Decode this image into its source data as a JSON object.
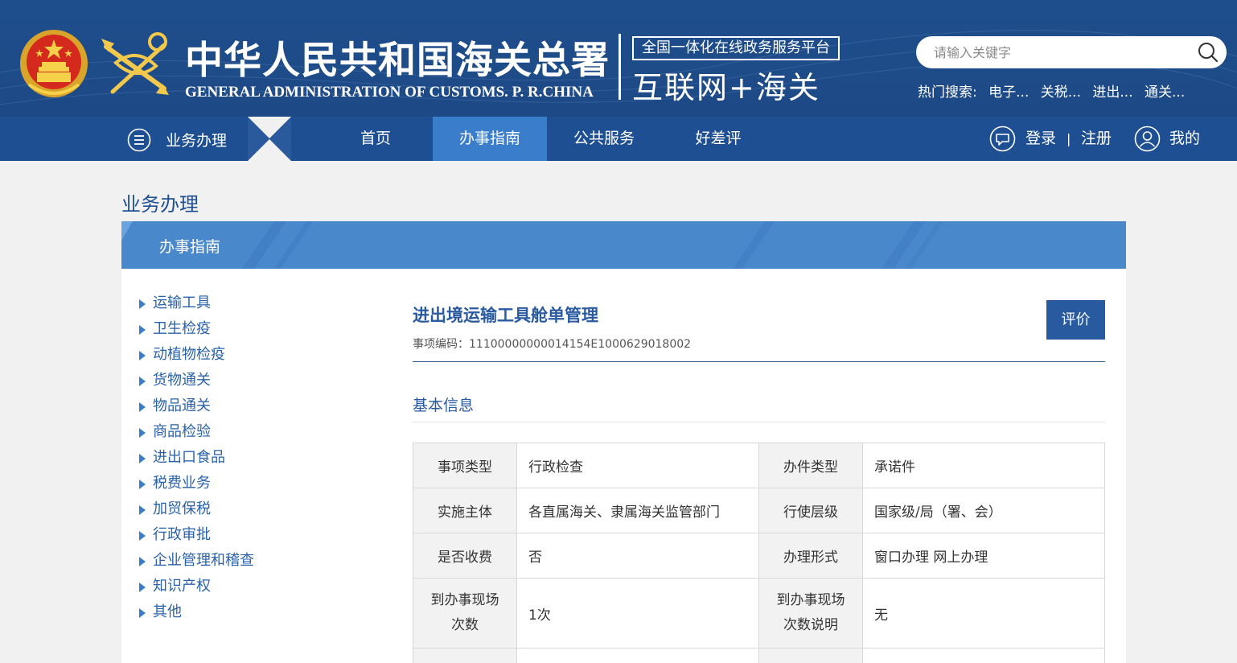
{
  "header": {
    "title_cn": "中华人民共和国海关总署",
    "title_en": "GENERAL ADMINISTRATION OF CUSTOMS. P. R.CHINA",
    "platform_box": "全国一体化在线政务服务平台",
    "platform_big": "互联网+海关",
    "search": {
      "placeholder": "请输入关键字"
    },
    "hot_label": "热门搜索:",
    "hot_items": [
      "电子...",
      "关税...",
      "进出...",
      "通关..."
    ]
  },
  "nav": {
    "biz_label": "业务办理",
    "items": [
      "首页",
      "办事指南",
      "公共服务",
      "好差评"
    ],
    "active_index": 1,
    "login": "登录",
    "separator": "|",
    "register": "注册",
    "mine": "我的"
  },
  "page": {
    "title": "业务办理",
    "banner": "办事指南"
  },
  "sidebar": {
    "items": [
      "运输工具",
      "卫生检疫",
      "动植物检疫",
      "货物通关",
      "物品通关",
      "商品检验",
      "进出口食品",
      "税费业务",
      "加贸保税",
      "行政审批",
      "企业管理和稽查",
      "知识产权",
      "其他"
    ]
  },
  "detail": {
    "title": "进出境运输工具舱单管理",
    "code": "事项编码：11100000000014154E1000629018002",
    "eval_button": "评价",
    "section": "基本信息",
    "rows": [
      {
        "k1": "事项类型",
        "v1": "行政检查",
        "k2": "办件类型",
        "v2": "承诺件"
      },
      {
        "k1": "实施主体",
        "v1": "各直属海关、隶属海关监管部门",
        "k2": "行使层级",
        "v2": "国家级/局（署、会）"
      },
      {
        "k1": "是否收费",
        "v1": "否",
        "k2": "办理形式",
        "v2": "窗口办理 网上办理"
      },
      {
        "k1": "到办事现场次数",
        "v1": "1次",
        "k2": "到办事现场次数说明",
        "v2": "无"
      }
    ]
  },
  "colors": {
    "header_bg": "#1f4e8c",
    "nav_bg": "#1f4f93",
    "nav_active": "#3a7ecb",
    "banner": "#4a88cc",
    "link": "#2a62aa",
    "button": "#285aa0"
  }
}
